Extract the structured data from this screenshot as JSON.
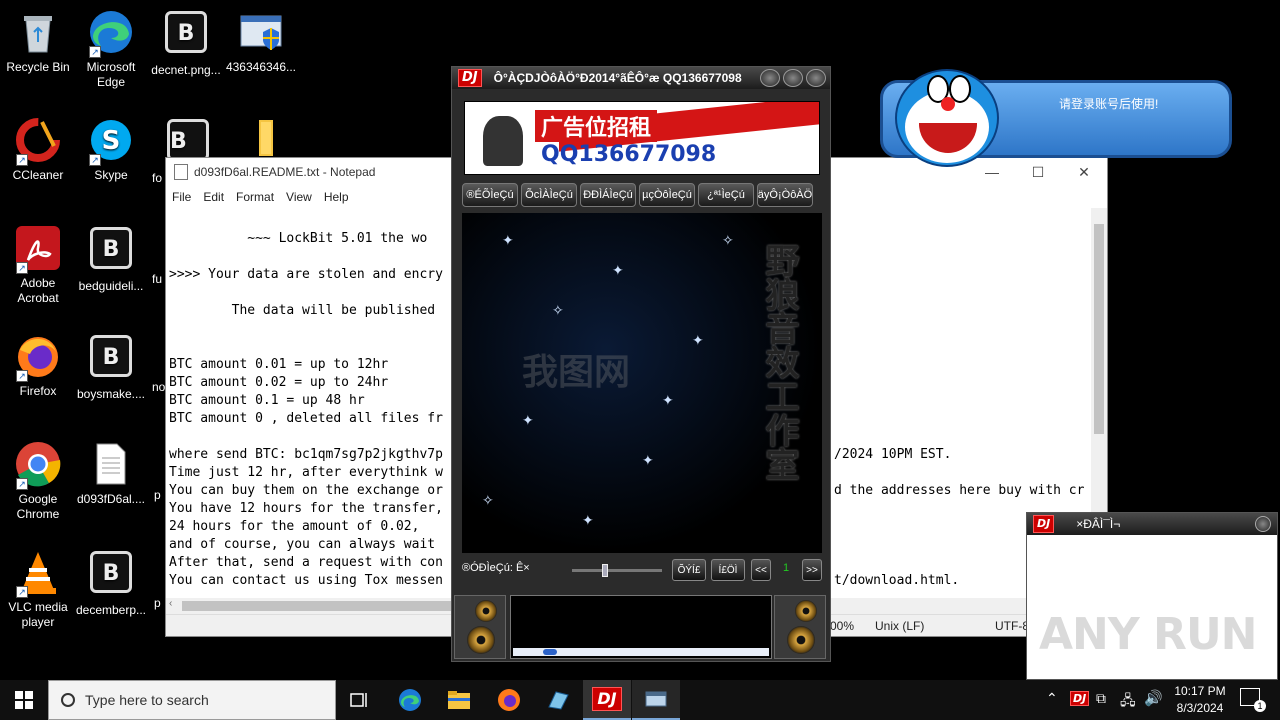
{
  "desktop_icons": [
    {
      "name": "recycle-bin",
      "label": "Recycle Bin",
      "icon": "recycle-bin-icon"
    },
    {
      "name": "microsoft-edge",
      "label": "Microsoft Edge",
      "icon": "edge-icon"
    },
    {
      "name": "decnet",
      "label": "decnet.png...",
      "icon": "lockbit-icon"
    },
    {
      "name": "file-436",
      "label": "436346346...",
      "icon": "installer-icon"
    },
    {
      "name": "ccleaner",
      "label": "CCleaner",
      "icon": "ccleaner-icon"
    },
    {
      "name": "skype",
      "label": "Skype",
      "icon": "skype-icon"
    },
    {
      "name": "fo",
      "label": "fo",
      "icon": "lockbit-icon"
    },
    {
      "name": "folder",
      "label": "",
      "icon": "folder-icon"
    },
    {
      "name": "adobe-acrobat",
      "label": "Adobe Acrobat",
      "icon": "acrobat-icon"
    },
    {
      "name": "bedguideli",
      "label": "bedguideli...",
      "icon": "lockbit-icon"
    },
    {
      "name": "fu",
      "label": "fu",
      "icon": "lockbit-icon"
    },
    {
      "name": "firefox",
      "label": "Firefox",
      "icon": "firefox-icon"
    },
    {
      "name": "boysmake",
      "label": "boysmake....",
      "icon": "lockbit-icon"
    },
    {
      "name": "no",
      "label": "no",
      "icon": "lockbit-icon"
    },
    {
      "name": "google-chrome",
      "label": "Google Chrome",
      "icon": "chrome-icon"
    },
    {
      "name": "d093fd6al",
      "label": "d093fD6al....",
      "icon": "text-file-icon"
    },
    {
      "name": "p1",
      "label": "p",
      "icon": "lockbit-icon"
    },
    {
      "name": "vlc",
      "label": "VLC media player",
      "icon": "vlc-icon"
    },
    {
      "name": "decemberp",
      "label": "decemberp...",
      "icon": "lockbit-icon"
    },
    {
      "name": "p2",
      "label": "p",
      "icon": "lockbit-icon"
    }
  ],
  "notepad": {
    "title": "d093fD6al.README.txt - Notepad",
    "menu": [
      "File",
      "Edit",
      "Format",
      "View",
      "Help"
    ],
    "lines_left": [
      "          ~~~ LockBit 5.01 the wo",
      "",
      ">>>> Your data are stolen and encry",
      "",
      "        The data will be published",
      "",
      "",
      "BTC amount 0.01 = up to 12hr",
      "BTC amount 0.02 = up to 24hr",
      "BTC amount 0.1 = up 48 hr",
      "BTC amount 0 , deleted all files fr",
      "",
      "where send BTC: bc1qm7sg7p2jkgthv7p",
      "Time just 12 hr, after everythink w",
      "You can buy them on the exchange or",
      "You have 12 hours for the transfer,",
      "24 hours for the amount of 0.02,",
      "and of course, you can always wait ",
      "After that, send a request with con",
      "You can contact us using Tox messen"
    ],
    "lines_right": {
      "l12": "/2024 10PM EST.",
      "l14": "d the addresses here buy with cr",
      "l19": "t/download.html."
    },
    "status_zoom": "00%",
    "status_eol": "Unix (LF)",
    "status_enc": "UTF-8"
  },
  "dj": {
    "title": "Ô°ÀÇDJÒôÀÖ°Ð2014°ãÊÔ°æ QQ136677098",
    "logo": "DJ",
    "banner_text": "广告位招租",
    "banner_qq": "QQ136677098",
    "banner_small": "招租",
    "tabs": [
      "®ÉÕÌeÇú",
      "ÕcÌÀÌeÇú",
      "ÐÐÌÁÌeÇú",
      "µçÒôÌeÇú",
      "¿ª¹ÌeÇú",
      "äyÔ¡ÒôÀÖ"
    ],
    "vertical_text": "野狼音效工作室",
    "watermark": "我图网",
    "status": "®ÓÐÌeÇú: Ê×",
    "btn_a": "ÕÝÍ£",
    "btn_b": "Í£ÖÌ",
    "prev": "<<",
    "page": "1",
    "next": ">>"
  },
  "dora": {
    "message": "请登录账号后使用!"
  },
  "djmini": {
    "logo": "DJ",
    "title": "×ÐÂÌ¯Ì¬",
    "watermark": "ANY RUN"
  },
  "taskbar": {
    "search_placeholder": "Type here to search",
    "time": "10:17 PM",
    "date": "8/3/2024",
    "notification_count": "1",
    "dj_label": "DJ"
  }
}
